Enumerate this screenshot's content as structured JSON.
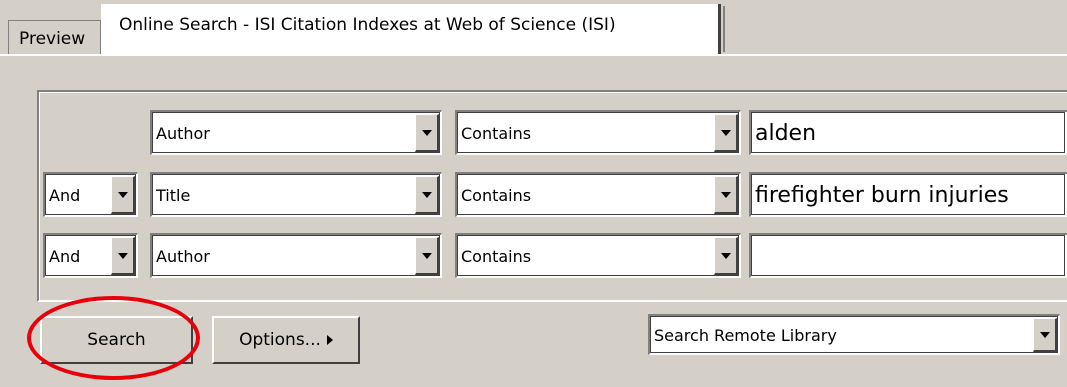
{
  "tabs": {
    "preview_label": "Preview",
    "online_label": "Online Search - ISI Citation Indexes at Web of Science (ISI)"
  },
  "search": {
    "rows": [
      {
        "operator": "",
        "field": "Author",
        "condition": "Contains",
        "value": "alden"
      },
      {
        "operator": "And",
        "field": "Title",
        "condition": "Contains",
        "value": "firefighter burn injuries"
      },
      {
        "operator": "And",
        "field": "Author",
        "condition": "Contains",
        "value": ""
      }
    ]
  },
  "actions": {
    "search_label": "Search",
    "options_label": "Options...",
    "scope_value": "Search Remote Library"
  },
  "colors": {
    "window_bg": "#d4d0c8",
    "highlight": "#e8000b"
  }
}
